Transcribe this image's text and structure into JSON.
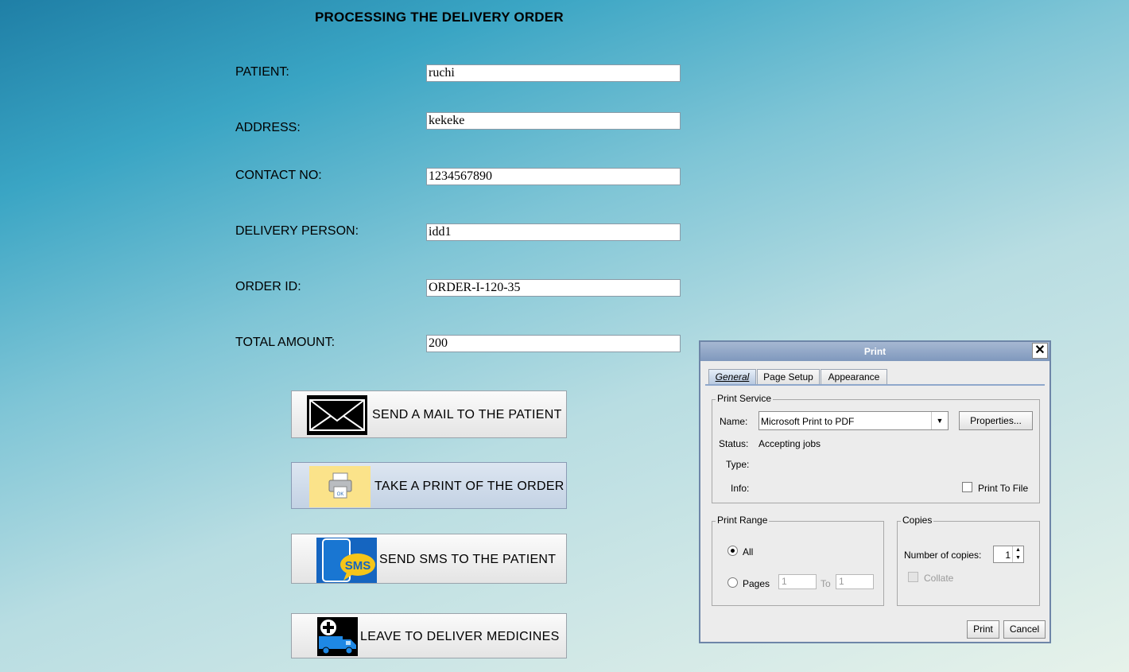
{
  "page_title": "PROCESSING THE DELIVERY ORDER",
  "form": {
    "patient_label": "PATIENT:",
    "patient_value": "ruchi",
    "address_label": "ADDRESS:",
    "address_value": "kekeke",
    "contact_label": "CONTACT NO:",
    "contact_value": "1234567890",
    "delivery_person_label": "DELIVERY PERSON:",
    "delivery_person_value": "idd1",
    "order_id_label": "ORDER ID:",
    "order_id_value": "ORDER-I-120-35",
    "total_amount_label": "TOTAL AMOUNT:",
    "total_amount_value": "200"
  },
  "actions": {
    "send_mail": "SEND A MAIL TO THE PATIENT",
    "take_print": "TAKE A PRINT OF THE ORDER",
    "send_sms": "SEND SMS TO THE PATIENT",
    "leave_deliver": "LEAVE TO DELIVER MEDICINES",
    "sms_icon_text": "SMS",
    "printer_icon_text": "OK"
  },
  "print_dialog": {
    "title": "Print",
    "close_glyph": "✕",
    "tabs": [
      "General",
      "Page Setup",
      "Appearance"
    ],
    "selected_tab": "General",
    "print_service": {
      "group_title": "Print Service",
      "name_label": "Name:",
      "name_value": "Microsoft Print to PDF",
      "properties_button": "Properties...",
      "status_label": "Status:",
      "status_value": "Accepting jobs",
      "type_label": "Type:",
      "info_label": "Info:",
      "print_to_file_label": "Print To File",
      "print_to_file_checked": false
    },
    "print_range": {
      "group_title": "Print Range",
      "all_label": "All",
      "all_selected": true,
      "pages_label": "Pages",
      "pages_from": "1",
      "to_label": "To",
      "pages_to": "1"
    },
    "copies": {
      "group_title": "Copies",
      "number_label": "Number of copies:",
      "number_value": "1",
      "collate_label": "Collate",
      "collate_checked": false
    },
    "print_button": "Print",
    "cancel_button": "Cancel"
  },
  "colors": {
    "dialog_title_bar": "#7f98bd",
    "print_button_hover": "#c3d2e4",
    "sms_blue": "#1565c0",
    "sms_bubble": "#f5c518"
  }
}
